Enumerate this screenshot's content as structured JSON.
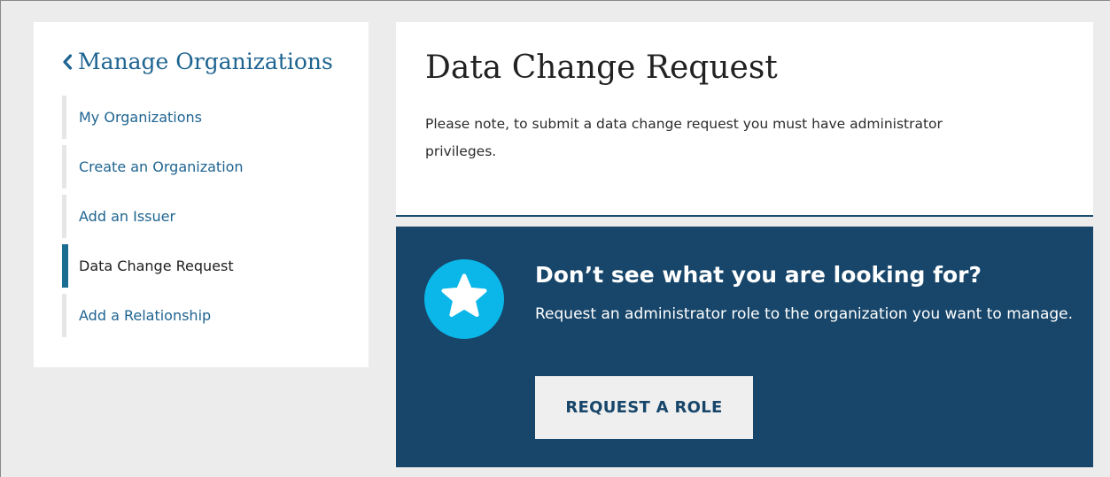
{
  "sidebar": {
    "title": "Manage Organizations",
    "items": [
      {
        "label": "My Organizations",
        "active": false
      },
      {
        "label": "Create an Organization",
        "active": false
      },
      {
        "label": "Add an Issuer",
        "active": false
      },
      {
        "label": "Data Change Request",
        "active": true
      },
      {
        "label": "Add a Relationship",
        "active": false
      }
    ]
  },
  "main": {
    "title": "Data Change Request",
    "note": "Please note, to submit a data change request you must have administrator privileges."
  },
  "callout": {
    "heading": "Don’t see what you are looking for?",
    "text": "Request an administrator role to the organization you want to manage.",
    "button_label": "REQUEST A ROLE",
    "icon": "star-icon"
  },
  "colors": {
    "link": "#1e6491",
    "active_bar": "#1b6d92",
    "callout_bg": "#17466a",
    "star_circle": "#0ab7e8",
    "page_bg": "#ececec"
  }
}
